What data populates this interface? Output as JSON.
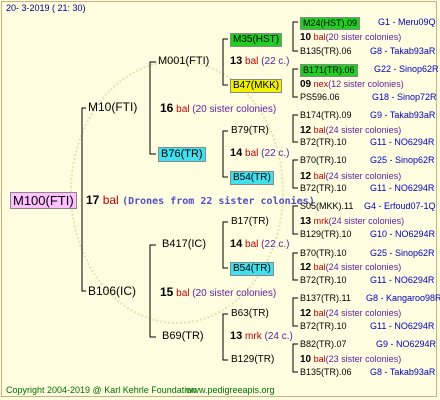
{
  "header": {
    "date": "20-  3-2019 (  21:  30)"
  },
  "footer": {
    "copyright": "Copyright 2004-2019 @ Karl Kehrle Foundation",
    "site": "www.pedigreeapis.org"
  },
  "colors": {
    "background": "#fffde0",
    "root": "#ffc0ff",
    "cyan": "#40e0f0",
    "green": "#20d020",
    "yellow": "#f0f000",
    "bal": "#c00000",
    "info": "#0000c0"
  },
  "root": {
    "name": "M100(FTI)",
    "num": "17",
    "unit": "bal",
    "note": "(Drones from 22 sister colonies)"
  },
  "gen1": [
    {
      "name": "M10(FTI)",
      "num": "16",
      "unit": "bal",
      "note": "(20 sister colonies)"
    },
    {
      "name": "B106(IC)",
      "num": "15",
      "unit": "bal",
      "note": "(20 sister colonies)"
    }
  ],
  "gen2": [
    {
      "name": "M001(FTI)",
      "num": "13",
      "unit": "bal",
      "note": "(22 c.)"
    },
    {
      "name": "B76(TR)",
      "num": "14",
      "unit": "bal",
      "note": "(22 c.)"
    },
    {
      "name": "B417(IC)",
      "num": "14",
      "unit": "bal",
      "note": "(22 c.)"
    },
    {
      "name": "B69(TR)",
      "num": "13",
      "unit": "mrk",
      "note": "(24 c.)"
    }
  ],
  "gen3": [
    {
      "name": "M35(HST)",
      "num": "10",
      "unit": "bal",
      "note": "(20 sister colonies)"
    },
    {
      "name": "B47(MKK)",
      "num": "09",
      "unit": "nex",
      "note": "(12 sister colonies)"
    },
    {
      "name": "B79(TR)",
      "num": "12",
      "unit": "bal",
      "note": "(24 sister colonies)"
    },
    {
      "name": "B54(TR)",
      "num": "12",
      "unit": "bal",
      "note": "(24 sister colonies)"
    },
    {
      "name": "B17(TR)",
      "num": "13",
      "unit": "mrk",
      "note": "(24 sister colonies)"
    },
    {
      "name": "B54(TR)",
      "num": "12",
      "unit": "bal",
      "note": "(24 sister colonies)"
    },
    {
      "name": "B63(TR)",
      "num": "12",
      "unit": "bal",
      "note": "(24 sister colonies)"
    },
    {
      "name": "B129(TR)",
      "num": "10",
      "unit": "bal",
      "note": "(23 sister colonies)"
    }
  ],
  "gen4": [
    {
      "name": "M24(HST).09",
      "info": "G1 - Meru09Q"
    },
    {
      "name": "B135(TR).06",
      "info": "G8 - Takab93aR"
    },
    {
      "name": "B171(TR).06",
      "info": "G22 - Sinop62R"
    },
    {
      "name": "PS596.06",
      "info": "G18 - Sinop72R"
    },
    {
      "name": "B174(TR).09",
      "info": "G9 - Takab93aR"
    },
    {
      "name": "B72(TR).10",
      "info": "G11 - NO6294R"
    },
    {
      "name": "B70(TR).10",
      "info": "G25 - Sinop62R"
    },
    {
      "name": "B72(TR).10",
      "info": "G11 - NO6294R"
    },
    {
      "name": "S05(MKK).11",
      "info": "G4 - Erfoud07-1Q"
    },
    {
      "name": "B129(TR).10",
      "info": "G10 - NO6294R"
    },
    {
      "name": "B70(TR).10",
      "info": "G25 - Sinop62R"
    },
    {
      "name": "B72(TR).10",
      "info": "G11 - NO6294R"
    },
    {
      "name": "B137(TR).11",
      "info": "G8 - Kangaroo98R"
    },
    {
      "name": "B72(TR).10",
      "info": "G11 - NO6294R"
    },
    {
      "name": "B82(TR).07",
      "info": "G9 - NO6294R"
    },
    {
      "name": "B135(TR).06",
      "info": "G8 - Takab93aR"
    }
  ]
}
